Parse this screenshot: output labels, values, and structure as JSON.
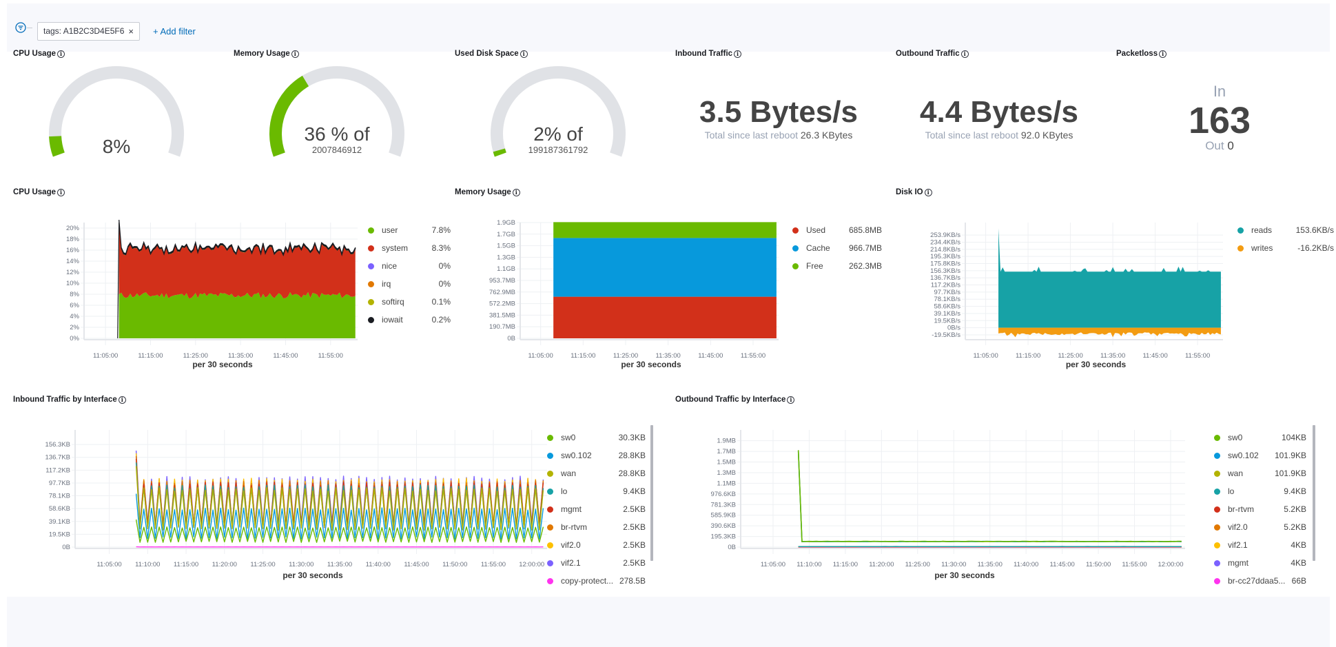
{
  "filterbar": {
    "filter_icon": "filter-icon",
    "pill_label": "tags: A1B2C3D4E5F6",
    "pill_remove": "×",
    "add_filter": "+ Add filter"
  },
  "info_glyph": "i",
  "colors": {
    "green": "#6aba00",
    "red": "#d2301a",
    "blue": "#0799dc",
    "teal": "#17a2a6",
    "orange": "#f39c12",
    "olive": "#b3b300",
    "purple": "#7b61ff",
    "amber": "#e17800",
    "yellow": "#fdc000",
    "magenta": "#ff33ee",
    "gauge_bg": "#e0e2e6"
  },
  "gauges": [
    {
      "title": "CPU Usage",
      "value_pct": 8,
      "main": "8%",
      "sub": ""
    },
    {
      "title": "Memory Usage",
      "value_pct": 36,
      "main": "36 % of",
      "sub": "2007846912"
    },
    {
      "title": "Used Disk Space",
      "value_pct": 2,
      "main": "2% of",
      "sub": "199187361792"
    }
  ],
  "traffic": [
    {
      "title": "Inbound Traffic",
      "value": "3.5 Bytes/s",
      "sub_label": "Total since last reboot",
      "sub_value": "26.3 KBytes"
    },
    {
      "title": "Outbound Traffic",
      "value": "4.4 Bytes/s",
      "sub_label": "Total since last reboot",
      "sub_value": "92.0 KBytes"
    }
  ],
  "packetloss": {
    "title": "Packetloss",
    "in_label": "In",
    "in_value": "163",
    "out_label": "Out",
    "out_value": "0"
  },
  "chart_data": [
    {
      "id": "cpu",
      "type": "area",
      "stacked": true,
      "title": "CPU Usage",
      "xlabel": "per 30 seconds",
      "ylabel": "",
      "x_ticks": [
        "11:05:00",
        "11:15:00",
        "11:25:00",
        "11:35:00",
        "11:45:00",
        "11:55:00"
      ],
      "y_ticks": [
        "0%",
        "2%",
        "4%",
        "6%",
        "8%",
        "10%",
        "12%",
        "14%",
        "16%",
        "18%",
        "20%"
      ],
      "ylim": [
        0,
        20
      ],
      "x_range_minutes": [
        1,
        61
      ],
      "data_start_minute": 8,
      "series": [
        {
          "name": "user",
          "legend_value": "7.8%",
          "color": "#6aba00",
          "base": 7.8,
          "noise": 0.6
        },
        {
          "name": "system",
          "legend_value": "8.3%",
          "color": "#d2301a",
          "base": 8.3,
          "noise": 0.7
        },
        {
          "name": "nice",
          "legend_value": "0%",
          "color": "#7b61ff",
          "base": 0,
          "noise": 0
        },
        {
          "name": "irq",
          "legend_value": "0%",
          "color": "#e17800",
          "base": 0,
          "noise": 0
        },
        {
          "name": "softirq",
          "legend_value": "0.1%",
          "color": "#b3b300",
          "base": 0.1,
          "noise": 0
        },
        {
          "name": "iowait",
          "legend_value": "0.2%",
          "color": "#1a1c21",
          "base": 0.2,
          "noise": 0.05
        }
      ],
      "spike_at_start": 21
    },
    {
      "id": "memory",
      "type": "area",
      "stacked": true,
      "title": "Memory Usage",
      "xlabel": "per 30 seconds",
      "x_ticks": [
        "11:05:00",
        "11:15:00",
        "11:25:00",
        "11:35:00",
        "11:45:00",
        "11:55:00"
      ],
      "y_ticks": [
        "0B",
        "190.7MB",
        "381.5MB",
        "572.2MB",
        "762.9MB",
        "953.7MB",
        "1.1GB",
        "1.3GB",
        "1.5GB",
        "1.7GB",
        "1.9GB"
      ],
      "ylim_mb": [
        0,
        1907
      ],
      "x_range_minutes": [
        1,
        61
      ],
      "data_start_minute": 8,
      "series": [
        {
          "name": "Used",
          "legend_value": "685.8MB",
          "color": "#d2301a",
          "mb": 685.8
        },
        {
          "name": "Cache",
          "legend_value": "966.7MB",
          "color": "#0799dc",
          "mb": 966.7
        },
        {
          "name": "Free",
          "legend_value": "262.3MB",
          "color": "#6aba00",
          "mb": 262.3
        }
      ]
    },
    {
      "id": "diskio",
      "type": "area",
      "title": "Disk IO",
      "xlabel": "per 30 seconds",
      "x_ticks": [
        "11:05:00",
        "11:15:00",
        "11:25:00",
        "11:35:00",
        "11:45:00",
        "11:55:00"
      ],
      "y_ticks": [
        "-19.5KB/s",
        "0B/s",
        "19.5KB/s",
        "39.1KB/s",
        "58.6KB/s",
        "78.1KB/s",
        "97.7KB/s",
        "117.2KB/s",
        "136.7KB/s",
        "156.3KB/s",
        "175.8KB/s",
        "195.3KB/s",
        "214.8KB/s",
        "234.4KB/s",
        "253.9KB/s"
      ],
      "ylim_kbs": [
        -29,
        273
      ],
      "x_range_minutes": [
        1,
        61
      ],
      "data_start_minute": 8,
      "series": [
        {
          "name": "reads",
          "legend_value": "153.6KB/s",
          "color": "#17a2a6",
          "base": 153.6,
          "spike_at_start": 272
        },
        {
          "name": "writes",
          "legend_value": "-16.2KB/s",
          "color": "#f39c12",
          "base": -16.2
        }
      ]
    },
    {
      "id": "inbound",
      "type": "line",
      "title": "Inbound Traffic by Interface",
      "xlabel": "per 30 seconds",
      "x_ticks": [
        "11:05:00",
        "11:10:00",
        "11:15:00",
        "11:20:00",
        "11:25:00",
        "11:30:00",
        "11:35:00",
        "11:40:00",
        "11:45:00",
        "11:50:00",
        "11:55:00",
        "12:00:00"
      ],
      "y_ticks": [
        "0B",
        "19.5KB",
        "39.1KB",
        "58.6KB",
        "78.1KB",
        "97.7KB",
        "117.2KB",
        "136.7KB",
        "156.3KB"
      ],
      "ylim_kb": [
        0,
        170
      ],
      "x_range_minutes": [
        1,
        62
      ],
      "data_start_minute": 8.5,
      "series": [
        {
          "name": "sw0",
          "legend_value": "30.3KB",
          "color": "#6aba00",
          "hi": 30,
          "lo": 8
        },
        {
          "name": "sw0.102",
          "legend_value": "28.8KB",
          "color": "#0799dc",
          "hi": 58,
          "lo": 14
        },
        {
          "name": "wan",
          "legend_value": "28.8KB",
          "color": "#b3b300",
          "hi": 88,
          "lo": 28
        },
        {
          "name": "lo",
          "legend_value": "9.4KB",
          "color": "#17a2a6",
          "hi": 92,
          "lo": 30
        },
        {
          "name": "mgmt",
          "legend_value": "2.5KB",
          "color": "#d2301a",
          "hi": 96,
          "lo": 32
        },
        {
          "name": "br-rtvm",
          "legend_value": "2.5KB",
          "color": "#e17800",
          "hi": 99,
          "lo": 33
        },
        {
          "name": "vif2.0",
          "legend_value": "2.5KB",
          "color": "#fdc000",
          "hi": 102,
          "lo": 34
        },
        {
          "name": "vif2.1",
          "legend_value": "2.5KB",
          "color": "#7b61ff",
          "hi": 105,
          "lo": 35
        },
        {
          "name": "copy-protect...",
          "legend_value": "278.5B",
          "color": "#ff33ee",
          "hi": 0.3,
          "lo": 0.2
        }
      ]
    },
    {
      "id": "outbound",
      "type": "line",
      "title": "Outbound Traffic by Interface",
      "xlabel": "per 30 seconds",
      "x_ticks": [
        "11:05:00",
        "11:10:00",
        "11:15:00",
        "11:20:00",
        "11:25:00",
        "11:30:00",
        "11:35:00",
        "11:40:00",
        "11:45:00",
        "11:50:00",
        "11:55:00",
        "12:00:00"
      ],
      "y_ticks": [
        "0B",
        "195.3KB",
        "390.6KB",
        "585.9KB",
        "781.3KB",
        "976.6KB",
        "1.1MB",
        "1.3MB",
        "1.5MB",
        "1.7MB",
        "1.9MB"
      ],
      "ylim_kb": [
        0,
        2050
      ],
      "x_range_minutes": [
        1,
        62
      ],
      "data_start_minute": 8.5,
      "series": [
        {
          "name": "sw0",
          "legend_value": "104KB",
          "color": "#6aba00",
          "base": 104,
          "spike": 1780
        },
        {
          "name": "sw0.102",
          "legend_value": "101.9KB",
          "color": "#0799dc",
          "base": 101.9,
          "spike": 1760
        },
        {
          "name": "wan",
          "legend_value": "101.9KB",
          "color": "#b3b300",
          "base": 101.9,
          "spike": 1760
        },
        {
          "name": "lo",
          "legend_value": "9.4KB",
          "color": "#17a2a6",
          "base": 9.4,
          "spike": 9.4
        },
        {
          "name": "br-rtvm",
          "legend_value": "5.2KB",
          "color": "#d2301a",
          "base": 5.2,
          "spike": 5.2
        },
        {
          "name": "vif2.0",
          "legend_value": "5.2KB",
          "color": "#e17800",
          "base": 5.2,
          "spike": 5.2
        },
        {
          "name": "vif2.1",
          "legend_value": "4KB",
          "color": "#fdc000",
          "base": 4,
          "spike": 4
        },
        {
          "name": "mgmt",
          "legend_value": "4KB",
          "color": "#7b61ff",
          "base": 4,
          "spike": 4
        },
        {
          "name": "br-cc27ddaa5...",
          "legend_value": "66B",
          "color": "#ff33ee",
          "base": 0.07,
          "spike": 0.07
        }
      ]
    }
  ]
}
